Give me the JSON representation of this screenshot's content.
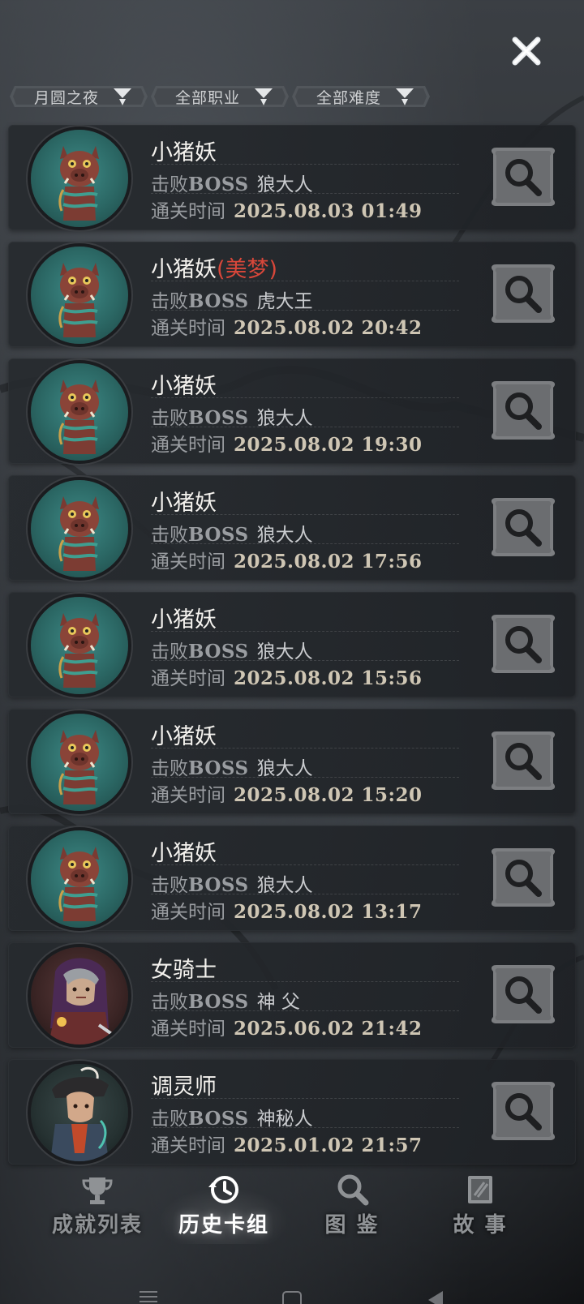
{
  "header": {
    "close_icon": "close-icon"
  },
  "filters": [
    {
      "label": "月圆之夜"
    },
    {
      "label": "全部职业"
    },
    {
      "label": "全部难度"
    }
  ],
  "records": [
    {
      "hero": "小猪妖",
      "suffix": "",
      "boss_prefix": "击败",
      "boss_word": "BOSS",
      "boss": "狼大人",
      "time_label": "通关时间",
      "time": "2025.08.03 01:49",
      "avatar": "pig-demon"
    },
    {
      "hero": "小猪妖",
      "suffix": "(美梦)",
      "boss_prefix": "击败",
      "boss_word": "BOSS",
      "boss": "虎大王",
      "time_label": "通关时间",
      "time": "2025.08.02 20:42",
      "avatar": "pig-demon"
    },
    {
      "hero": "小猪妖",
      "suffix": "",
      "boss_prefix": "击败",
      "boss_word": "BOSS",
      "boss": "狼大人",
      "time_label": "通关时间",
      "time": "2025.08.02 19:30",
      "avatar": "pig-demon"
    },
    {
      "hero": "小猪妖",
      "suffix": "",
      "boss_prefix": "击败",
      "boss_word": "BOSS",
      "boss": "狼大人",
      "time_label": "通关时间",
      "time": "2025.08.02 17:56",
      "avatar": "pig-demon"
    },
    {
      "hero": "小猪妖",
      "suffix": "",
      "boss_prefix": "击败",
      "boss_word": "BOSS",
      "boss": "狼大人",
      "time_label": "通关时间",
      "time": "2025.08.02 15:56",
      "avatar": "pig-demon"
    },
    {
      "hero": "小猪妖",
      "suffix": "",
      "boss_prefix": "击败",
      "boss_word": "BOSS",
      "boss": "狼大人",
      "time_label": "通关时间",
      "time": "2025.08.02 15:20",
      "avatar": "pig-demon"
    },
    {
      "hero": "小猪妖",
      "suffix": "",
      "boss_prefix": "击败",
      "boss_word": "BOSS",
      "boss": "狼大人",
      "time_label": "通关时间",
      "time": "2025.08.02 13:17",
      "avatar": "pig-demon"
    },
    {
      "hero": "女骑士",
      "suffix": "",
      "boss_prefix": "击败",
      "boss_word": "BOSS",
      "boss": "神 父",
      "time_label": "通关时间",
      "time": "2025.06.02 21:42",
      "avatar": "female-knight"
    },
    {
      "hero": "调灵师",
      "suffix": "",
      "boss_prefix": "击败",
      "boss_word": "BOSS",
      "boss": "神秘人",
      "time_label": "通关时间",
      "time": "2025.01.02 21:57",
      "avatar": "spirit-tuner"
    }
  ],
  "bottom_nav": [
    {
      "label": "成就列表",
      "icon": "trophy-icon",
      "active": false
    },
    {
      "label": "历史卡组",
      "icon": "history-icon",
      "active": true
    },
    {
      "label": "图 鉴",
      "icon": "magnifier-icon",
      "active": false
    },
    {
      "label": "故 事",
      "icon": "book-icon",
      "active": false
    }
  ],
  "colors": {
    "accent_red": "#d9473a",
    "time_text": "#cfc6b4",
    "muted_text": "#9a9da1",
    "active_nav": "#ffffff",
    "inactive_nav": "#8f9295"
  }
}
